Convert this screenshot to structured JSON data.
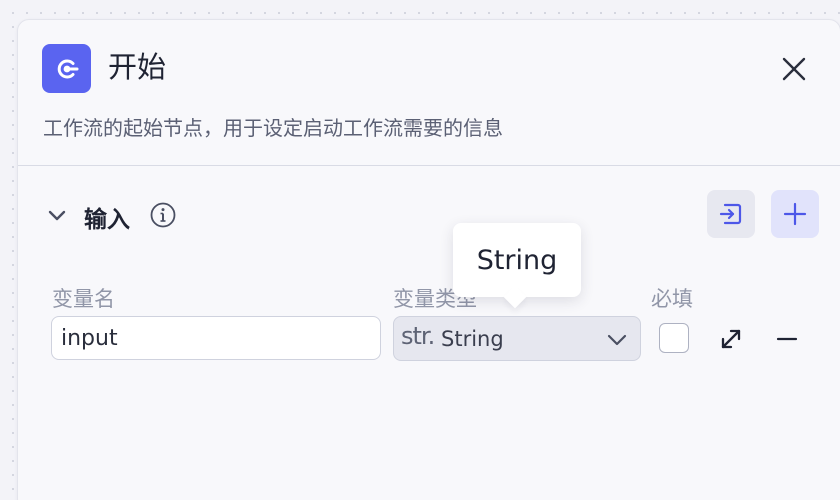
{
  "node": {
    "title": "开始",
    "description": "工作流的起始节点，用于设定启动工作流需要的信息",
    "icon": "start-node-icon",
    "accent_color": "#5a64f0"
  },
  "section": {
    "title": "输入",
    "info_icon": "info-icon",
    "import_icon": "import-icon",
    "add_icon": "plus-icon"
  },
  "columns": {
    "name": "变量名",
    "type": "变量类型",
    "required": "必填"
  },
  "variables": [
    {
      "name": "input",
      "type_prefix": "str.",
      "type": "String",
      "required": false
    }
  ],
  "tooltip": {
    "text": "String"
  }
}
